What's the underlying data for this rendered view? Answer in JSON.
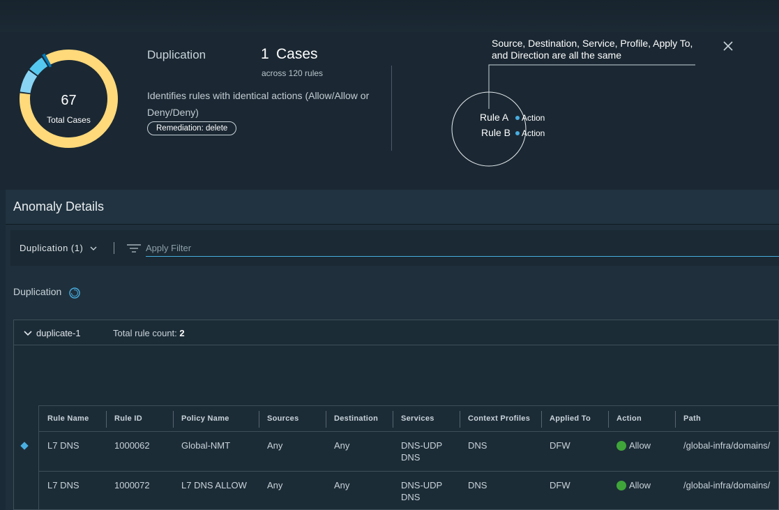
{
  "summary": {
    "total_cases": "67",
    "total_cases_label": "Total Cases",
    "category": "Duplication",
    "cases_count": "1",
    "cases_word": "Cases",
    "cases_sub": "across 120 rules",
    "description": "Identifies rules with identical actions (Allow/Allow or Deny/Deny)",
    "remediation": "Remediation: delete",
    "donut_segments": [
      {
        "color": "#ffd97a",
        "fraction": 0.85
      },
      {
        "color": "#89d4f5",
        "fraction": 0.08
      },
      {
        "color": "#55c8f0",
        "fraction": 0.06
      },
      {
        "color": "#0079b8",
        "fraction": 0.01
      }
    ]
  },
  "diagram": {
    "note": "Source, Destination, Service, Profile, Apply To, and Direction are all the same",
    "rule_a": "Rule A",
    "rule_b": "Rule B",
    "action_label": "Action",
    "dot_color": "#49aee0"
  },
  "anomaly": {
    "title": "Anomaly Details",
    "filter_dropdown": "Duplication (1)",
    "filter_placeholder": "Apply Filter",
    "section_label": "Duplication"
  },
  "group": {
    "name": "duplicate-1",
    "count_label": "Total rule count:",
    "count_value": "2"
  },
  "table": {
    "columns": [
      "Rule Name",
      "Rule ID",
      "Policy Name",
      "Sources",
      "Destination",
      "Services",
      "Context Profiles",
      "Applied To",
      "Action",
      "Path"
    ],
    "rows": [
      {
        "rule_name": "L7 DNS",
        "rule_id": "1000062",
        "policy": "Global-NMT",
        "sources": "Any",
        "destination": "Any",
        "services_1": "DNS-UDP",
        "services_2": "DNS",
        "context": "DNS",
        "applied_to": "DFW",
        "action": "Allow",
        "path": "/global-infra/domains/"
      },
      {
        "rule_name": "L7 DNS",
        "rule_id": "1000072",
        "policy": "L7 DNS ALLOW",
        "sources": "Any",
        "destination": "Any",
        "services_1": "DNS-UDP",
        "services_2": "DNS",
        "context": "DNS",
        "applied_to": "DFW",
        "action": "Allow",
        "path": "/global-infra/domains/"
      }
    ]
  }
}
